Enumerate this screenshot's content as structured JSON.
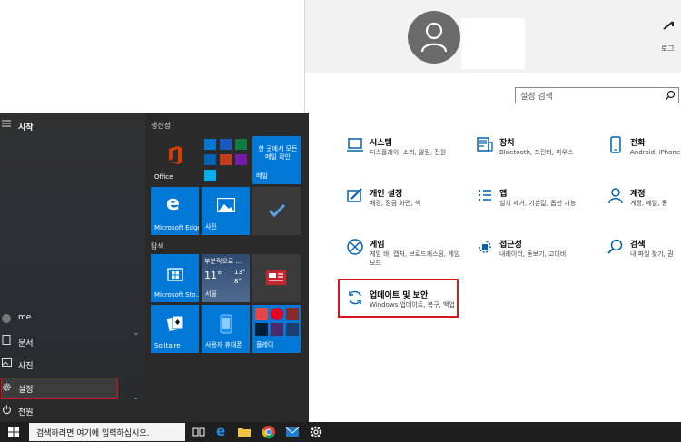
{
  "settings": {
    "corner_text": "로그",
    "search_placeholder": "설정 검색",
    "tiles": [
      {
        "title": "시스템",
        "desc": "디스플레이, 소리, 알림, 전원",
        "icon": "laptop-icon"
      },
      {
        "title": "장치",
        "desc": "Bluetooth, 프린터, 마우스",
        "icon": "devices-icon"
      },
      {
        "title": "전화",
        "desc": "Android, iPhone 연",
        "icon": "phone-icon"
      },
      {
        "title": "개인 설정",
        "desc": "배경, 잠금 화면, 색",
        "icon": "personalization-icon"
      },
      {
        "title": "앱",
        "desc": "설치 제거, 기본값, 옵션 기능",
        "icon": "apps-icon"
      },
      {
        "title": "계정",
        "desc": "계정, 메일, 동",
        "icon": "account-icon"
      },
      {
        "title": "게임",
        "desc": "게임 바, 캡처, 브로드캐스팅, 게임 모드",
        "icon": "xbox-icon"
      },
      {
        "title": "접근성",
        "desc": "내레이터, 돋보기, 고대비",
        "icon": "accessibility-icon"
      },
      {
        "title": "검색",
        "desc": "내 파일 찾기, 권",
        "icon": "search-icon"
      },
      {
        "title": "업데이트 및 보안",
        "desc": "Windows 업데이트, 복구, 백업",
        "icon": "sync-icon"
      }
    ]
  },
  "start_menu": {
    "header": "시작",
    "user": "me",
    "items": [
      "문서",
      "사진",
      "설정",
      "전원"
    ],
    "group1": "생산성",
    "group2": "탐색",
    "tiles": {
      "office": "Office",
      "mail_text": "한 곳에서 모든 메일 확인",
      "mail": "메일",
      "edge": "Microsoft Edge",
      "photos": "사진",
      "store": "Microsoft Sto...",
      "weather_top": "부분적으로 ...",
      "weather_temp": "11°",
      "weather_hi": "13°",
      "weather_lo": "8°",
      "weather_city": "서울",
      "solitaire": "Solitaire",
      "phone": "사용자 휴대폰",
      "play": "플레이"
    }
  },
  "taskbar": {
    "search_text": "검색하려면 여기에 입력하십시오."
  },
  "colors": {
    "accent": "#0078d7",
    "highlight_red": "#d8171d",
    "office_red": "#d83b01"
  }
}
